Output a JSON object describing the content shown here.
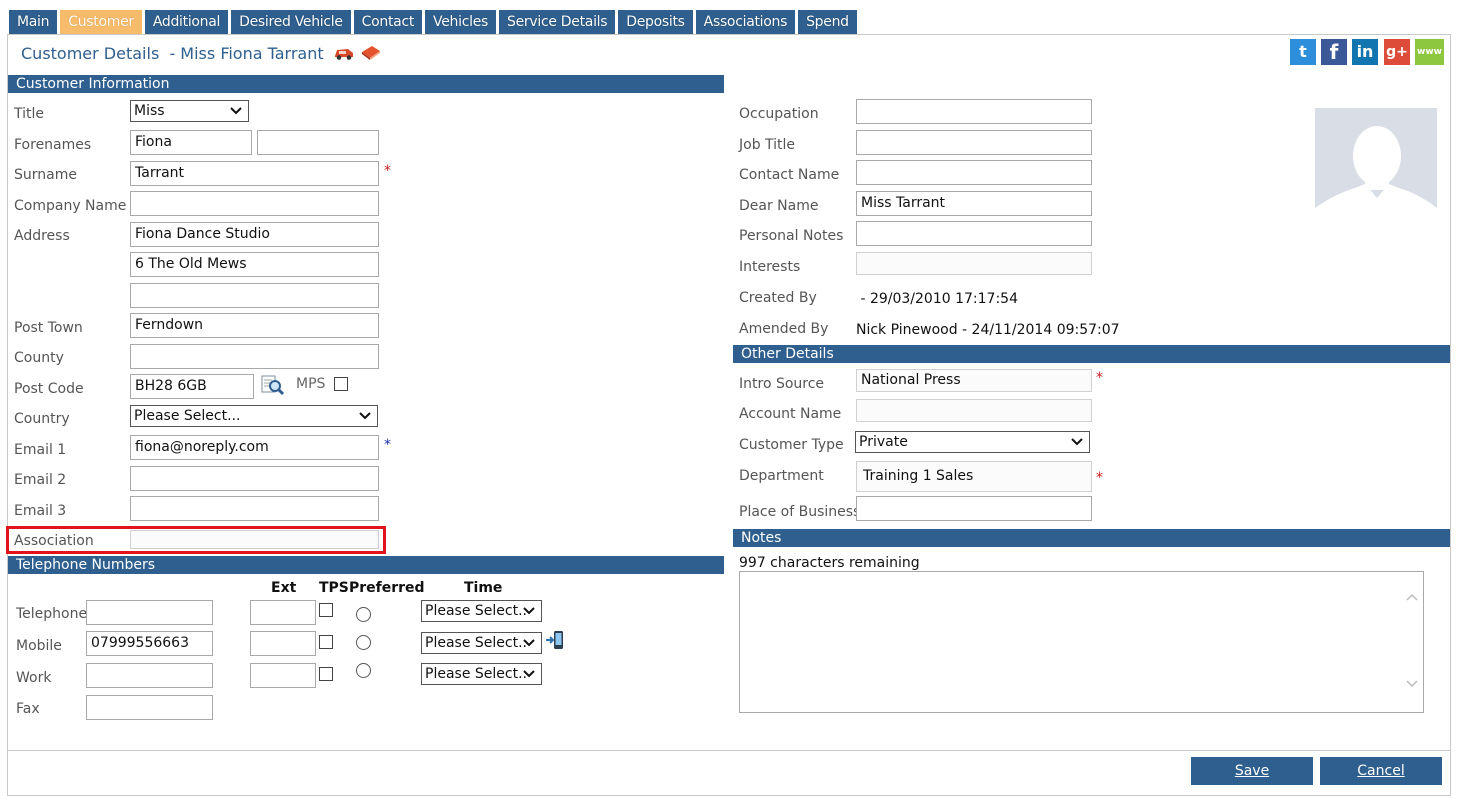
{
  "tabs": [
    "Main",
    "Customer",
    "Additional",
    "Desired Vehicle",
    "Contact",
    "Vehicles",
    "Service Details",
    "Deposits",
    "Associations",
    "Spend"
  ],
  "active_tab": "Customer",
  "header": {
    "title": "Customer Details  - Miss Fiona Tarrant"
  },
  "social": {
    "twitter": "t",
    "facebook": "f",
    "linkedin": "in",
    "google": "g+",
    "web": "www"
  },
  "sections": {
    "customer_info": "Customer Information",
    "telephone": "Telephone Numbers",
    "other": "Other Details",
    "notes": "Notes"
  },
  "customer": {
    "title_label": "Title",
    "title_value": "Miss",
    "forenames_label": "Forenames",
    "forename1": "Fiona",
    "forename2": "",
    "surname_label": "Surname",
    "surname": "Tarrant",
    "company_label": "Company Name",
    "company": "",
    "address_label": "Address",
    "address1": "Fiona Dance Studio",
    "address2": "6 The Old Mews",
    "address3": "",
    "posttown_label": "Post Town",
    "posttown": "Ferndown",
    "county_label": "County",
    "county": "",
    "postcode_label": "Post Code",
    "postcode": "BH28 6GB",
    "mps_label": "MPS",
    "country_label": "Country",
    "country": "Please Select...",
    "email1_label": "Email 1",
    "email1": "fiona@noreply.com",
    "email2_label": "Email 2",
    "email2": "",
    "email3_label": "Email 3",
    "email3": "",
    "association_label": "Association",
    "association": ""
  },
  "phones": {
    "col_ext": "Ext",
    "col_tps": "TPS",
    "col_pref": "Preferred",
    "col_time": "Time",
    "rows": [
      {
        "label": "Telephone",
        "number": "",
        "ext": "",
        "time": "Please Select.."
      },
      {
        "label": "Mobile",
        "number": "07999556663",
        "ext": "",
        "time": "Please Select.."
      },
      {
        "label": "Work",
        "number": "",
        "ext": "",
        "time": "Please Select.."
      },
      {
        "label": "Fax",
        "number": ""
      }
    ]
  },
  "right": {
    "occupation_label": "Occupation",
    "occupation": "",
    "jobtitle_label": "Job Title",
    "jobtitle": "",
    "contact_label": "Contact Name",
    "contact": "",
    "dear_label": "Dear Name",
    "dear": "Miss Tarrant",
    "notes_label": "Personal Notes",
    "personal_notes": "",
    "interests_label": "Interests",
    "interests": "",
    "created_label": "Created By",
    "created": " - 29/03/2010 17:17:54",
    "amended_label": "Amended By",
    "amended": "Nick Pinewood - 24/11/2014 09:57:07"
  },
  "other": {
    "intro_label": "Intro Source",
    "intro": "National Press",
    "account_label": "Account Name",
    "account": "",
    "type_label": "Customer Type",
    "type": "Private",
    "dept_label": "Department",
    "dept": "Training 1 Sales",
    "place_label": "Place of Business",
    "place": ""
  },
  "notes": {
    "remaining": "997 characters remaining",
    "text": ""
  },
  "buttons": {
    "save": "Save",
    "cancel": "Cancel"
  },
  "colors": {
    "accent": "#2e5f8e",
    "active_tab": "#f6bc6c",
    "required": "#cc1f1f"
  }
}
